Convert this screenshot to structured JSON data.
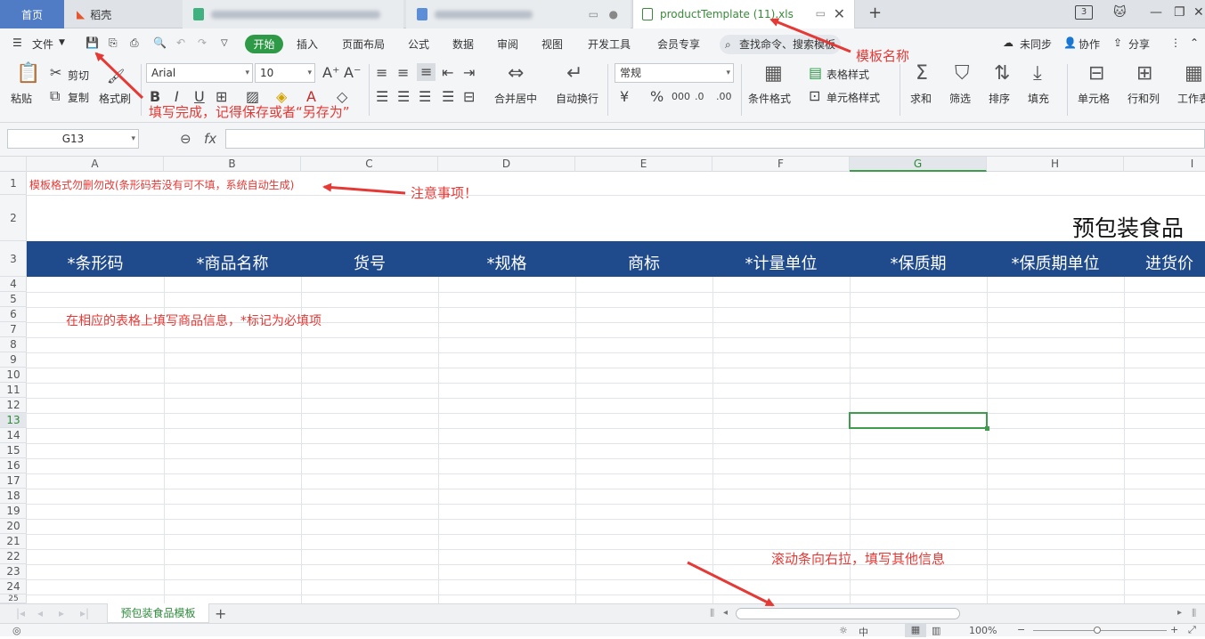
{
  "tabs": {
    "home": "首页",
    "daoke": "稻壳",
    "active_file": "productTemplate (11).xls",
    "sheet_count_badge": "3"
  },
  "menu": {
    "file": "文件",
    "items": [
      "开始",
      "插入",
      "页面布局",
      "公式",
      "数据",
      "审阅",
      "视图",
      "开发工具",
      "会员专享"
    ],
    "search_placeholder": "查找命令、搜索模板",
    "unsynced": "未同步",
    "collab": "协作",
    "share": "分享"
  },
  "ribbon": {
    "paste": "粘贴",
    "cut": "剪切",
    "copy": "复制",
    "format_painter": "格式刷",
    "font_name": "Arial",
    "font_size": "10",
    "merge_center": "合并居中",
    "wrap_text": "自动换行",
    "number_format": "常规",
    "conditional_format": "条件格式",
    "table_style": "表格样式",
    "cell_style": "单元格样式",
    "sum": "求和",
    "filter": "筛选",
    "sort": "排序",
    "fill": "填充",
    "cell": "单元格",
    "row_col": "行和列",
    "worksheet": "工作表"
  },
  "formula_bar": {
    "name_box": "G13",
    "fx": "fx",
    "value": ""
  },
  "grid": {
    "columns": [
      "A",
      "B",
      "C",
      "D",
      "E",
      "F",
      "G",
      "H",
      "I"
    ],
    "rows": [
      "1",
      "2",
      "3",
      "4",
      "5",
      "6",
      "7",
      "8",
      "9",
      "10",
      "11",
      "12",
      "13",
      "14",
      "15",
      "16",
      "17",
      "18",
      "19",
      "20",
      "21",
      "22",
      "23",
      "24",
      "25"
    ],
    "a1_note": "模板格式勿删勿改(条形码若没有可不填，系统自动生成)",
    "title": "预包装食品",
    "headers": [
      "*条形码",
      "*商品名称",
      "货号",
      "*规格",
      "商标",
      "*计量单位",
      "*保质期",
      "*保质期单位",
      "进货价"
    ],
    "fill_hint": "在相应的表格上填写商品信息，*标记为必填项",
    "selected_cell": "G13"
  },
  "annotations": {
    "template_name": "模板名称",
    "save_hint": "填写完成，记得保存或者“另存为”",
    "attention": "注意事项！",
    "scroll_hint": "滚动条向右拉，填写其他信息",
    "color": "#e53935"
  },
  "sheet": {
    "tab_name": "预包装食品模板"
  },
  "status": {
    "zoom": "100%"
  }
}
